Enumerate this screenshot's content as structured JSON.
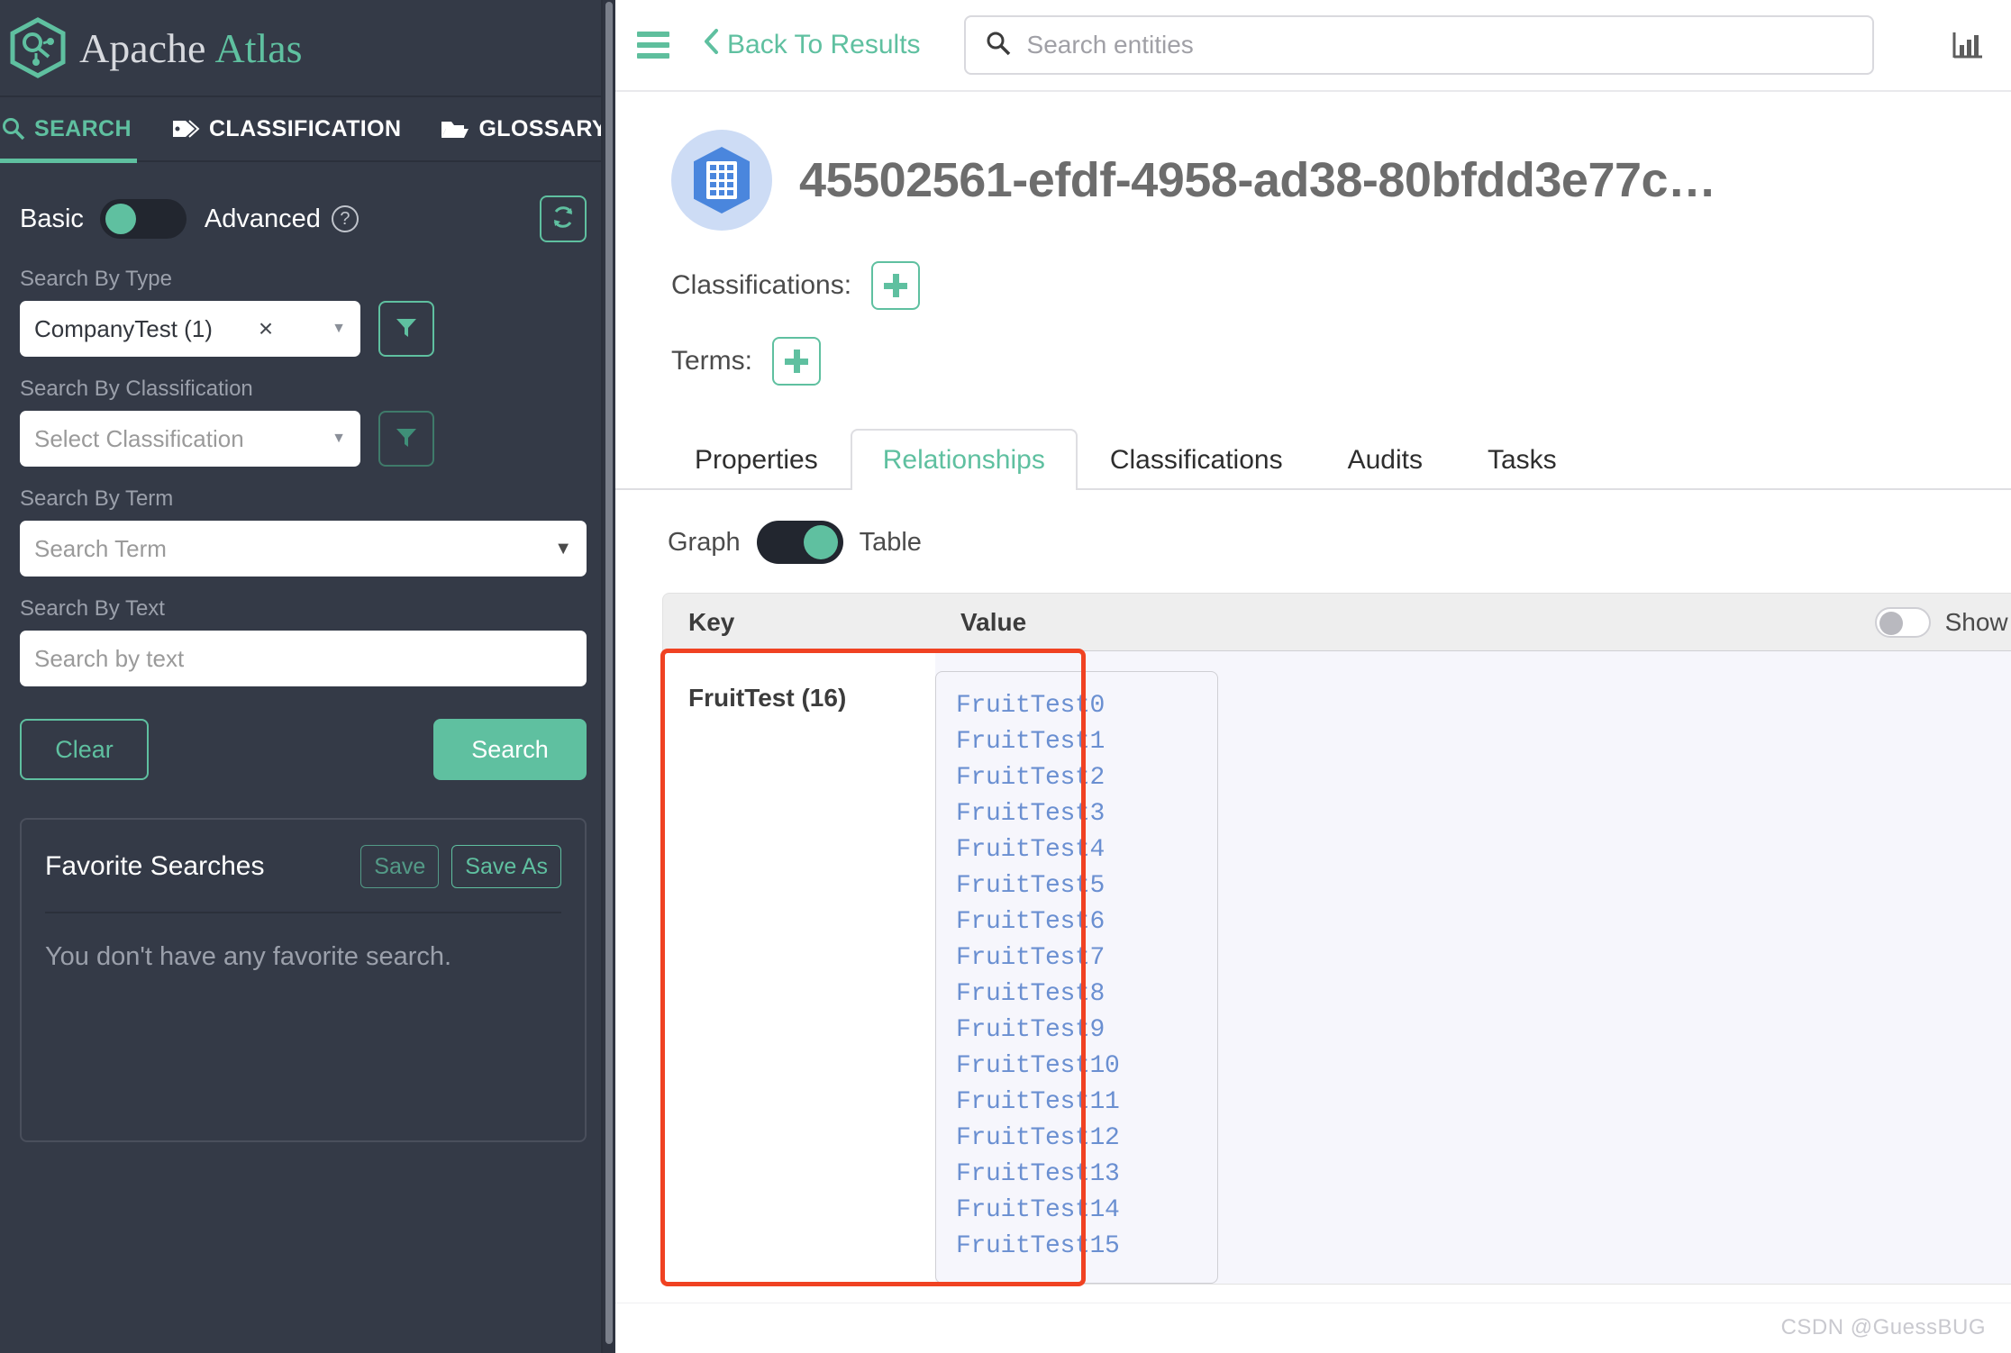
{
  "brand": {
    "logo_icon": "atlas-hexagon-logo",
    "name_primary": "Apache",
    "name_secondary": "Atlas"
  },
  "nav": {
    "items": [
      {
        "label": "SEARCH",
        "icon": "search-icon",
        "active": true
      },
      {
        "label": "CLASSIFICATION",
        "icon": "tag-icon",
        "active": false
      },
      {
        "label": "GLOSSARY",
        "icon": "folder-open-icon",
        "active": false
      }
    ]
  },
  "search_panel": {
    "mode_basic_label": "Basic",
    "mode_advanced_label": "Advanced",
    "mode_selected": "Basic",
    "help_icon": "question-circle-icon",
    "refresh_icon": "refresh-icon",
    "search_by_type": {
      "label": "Search By Type",
      "value": "CompanyTest (1)",
      "clear_icon": "clear-x-icon",
      "chevron_icon": "chevron-down-icon",
      "filter_icon": "filter-icon"
    },
    "search_by_classification": {
      "label": "Search By Classification",
      "placeholder": "Select Classification",
      "value": "",
      "chevron_icon": "chevron-down-icon",
      "filter_icon": "filter-icon"
    },
    "search_by_term": {
      "label": "Search By Term",
      "placeholder": "Search Term",
      "value": "",
      "chevron_icon": "chevron-down-icon"
    },
    "search_by_text": {
      "label": "Search By Text",
      "placeholder": "Search by text",
      "value": ""
    },
    "clear_button": "Clear",
    "search_button": "Search"
  },
  "favorites": {
    "title": "Favorite Searches",
    "save_label": "Save",
    "save_as_label": "Save As",
    "empty_message": "You don't have any favorite search."
  },
  "topbar": {
    "menu_icon": "hamburger-menu-icon",
    "back_icon": "chevron-left-icon",
    "back_label": "Back To Results",
    "search_icon": "search-icon",
    "search_placeholder": "Search entities",
    "search_value": "",
    "stats_icon": "bar-chart-icon"
  },
  "entity": {
    "avatar_icon": "table-entity-icon",
    "title": "45502561-efdf-4958-ad38-80bfdd3e77c…",
    "classifications_label": "Classifications:",
    "classifications_add_icon": "plus-icon",
    "terms_label": "Terms:",
    "terms_add_icon": "plus-icon"
  },
  "tabs": [
    {
      "label": "Properties",
      "active": false
    },
    {
      "label": "Relationships",
      "active": true
    },
    {
      "label": "Classifications",
      "active": false
    },
    {
      "label": "Audits",
      "active": false
    },
    {
      "label": "Tasks",
      "active": false
    }
  ],
  "view_toggle": {
    "left_label": "Graph",
    "right_label": "Table",
    "selected": "Table"
  },
  "relationship_table": {
    "columns": [
      "Key",
      "Value"
    ],
    "show_empty_label": "Show Emp",
    "show_empty_on": false,
    "rows": [
      {
        "key": "FruitTest (16)",
        "values": [
          "FruitTest0",
          "FruitTest1",
          "FruitTest2",
          "FruitTest3",
          "FruitTest4",
          "FruitTest5",
          "FruitTest6",
          "FruitTest7",
          "FruitTest8",
          "FruitTest9",
          "FruitTest10",
          "FruitTest11",
          "FruitTest12",
          "FruitTest13",
          "FruitTest14",
          "FruitTest15"
        ]
      }
    ]
  },
  "watermark": "CSDN @GuessBUG",
  "colors": {
    "accent_green": "#5fc0a0",
    "sidebar_bg": "#343a47",
    "highlight_red": "#f04222",
    "link_blue": "#6a8fd1",
    "entity_blue": "#4a86dd"
  }
}
